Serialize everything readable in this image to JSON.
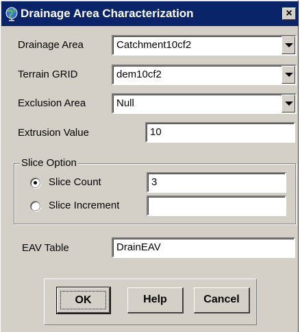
{
  "window": {
    "title": "Drainage Area Characterization",
    "close_label": "×",
    "icon": "globe-icon"
  },
  "form": {
    "drainage_area": {
      "label": "Drainage Area",
      "value": "Catchment10cf2"
    },
    "terrain_grid": {
      "label": "Terrain GRID",
      "value": "dem10cf2"
    },
    "exclusion_area": {
      "label": "Exclusion Area",
      "value": "Null"
    },
    "extrusion_value": {
      "label": "Extrusion Value",
      "value": "10"
    }
  },
  "slice_option": {
    "title": "Slice Option",
    "slice_count": {
      "label": "Slice Count",
      "value": "3",
      "selected": true
    },
    "slice_increment": {
      "label": "Slice Increment",
      "value": "",
      "selected": false
    }
  },
  "eav_table": {
    "label": "EAV Table",
    "value": "DrainEAV"
  },
  "buttons": {
    "ok": "OK",
    "help": "Help",
    "cancel": "Cancel"
  },
  "colors": {
    "titlebar": "#0a246a",
    "face": "#d4d0c8"
  }
}
